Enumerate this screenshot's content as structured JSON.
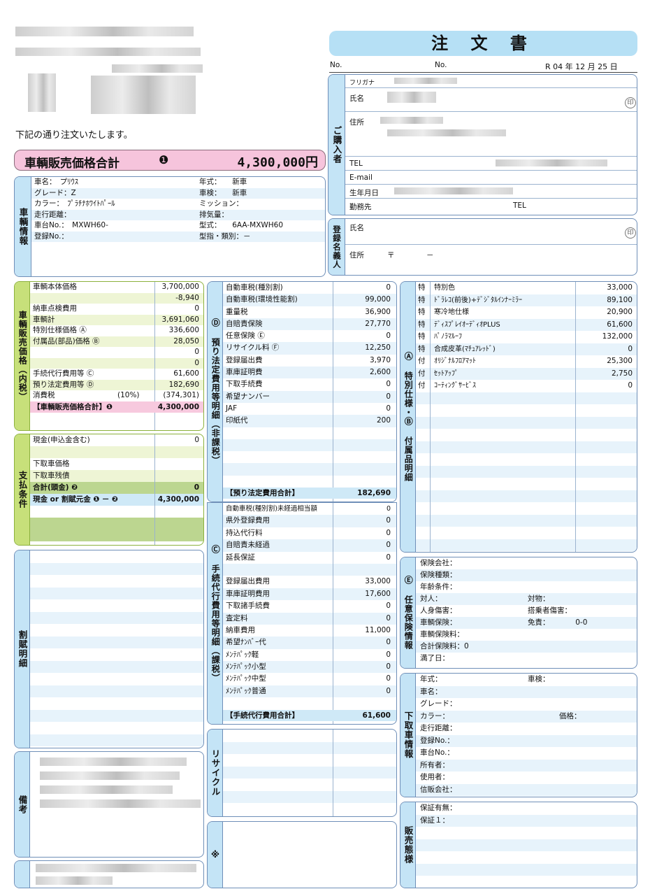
{
  "header": {
    "title": "注 文 書",
    "no_label1": "No.",
    "no_label2": "No.",
    "date": "R 04 年 12 月 25 日",
    "intro": "下記の通り注文いたします。"
  },
  "total": {
    "label": "車輌販売価格合計",
    "badge": "❶",
    "value": "4,300,000円"
  },
  "buyer": {
    "section": "ご購入者",
    "furigana": "フリガナ",
    "name": "氏名",
    "address": "住所",
    "tel": "TEL",
    "email": "E-mail",
    "birthday": "生年月日",
    "workplace": "勤務先",
    "work_tel": "TEL",
    "seal": "印"
  },
  "registrant": {
    "section": "登録名義人",
    "name": "氏名",
    "address": "住所",
    "postal": "〒",
    "dash": "－",
    "seal": "印"
  },
  "vehicle": {
    "section": "車輌情報",
    "rows": [
      [
        "車名：　プﾘｳｽ",
        "年式：　　新車"
      ],
      [
        "グレード：Z",
        "車検：　　新車"
      ],
      [
        "カラー：　ﾌﾟﾗﾁﾅﾎﾜｲﾄﾊﾟｰﾙ",
        "ミッション："
      ],
      [
        "走行距離：",
        "排気量："
      ],
      [
        "車台No.：　MXWH60-",
        "型式：　　6AA-MXWH60"
      ],
      [
        "登録No.：",
        "型指・類別：－"
      ]
    ]
  },
  "price": {
    "section": "車輌販売価格（内税）",
    "rows": [
      [
        "車輌本体価格",
        "3,700,000"
      ],
      [
        "",
        "-8,940"
      ],
      [
        "納車点検費用",
        "0"
      ],
      [
        "車輌計",
        "3,691,060"
      ],
      [
        "特別仕様価格 Ⓐ",
        "336,600"
      ],
      [
        "付属品(部品)価格 Ⓑ",
        "28,050"
      ],
      [
        "",
        "0"
      ],
      [
        "",
        "0"
      ],
      [
        "手続代行費用等 Ⓒ",
        "61,600"
      ],
      [
        "預り法定費用等 Ⓓ",
        "182,690"
      ],
      [
        "消費税",
        "(374,301)"
      ]
    ],
    "tax_rate": "(10%)",
    "total_label": "【車輌販売価格合計】❶",
    "total_value": "4,300,000"
  },
  "payment": {
    "section": "支払条件",
    "rows": [
      [
        "現金(申込金含む)",
        "0"
      ],
      [
        "",
        ""
      ],
      [
        "下取車価格",
        ""
      ],
      [
        "下取車残債",
        ""
      ],
      [
        "合計(頭金) ❷",
        "0"
      ],
      [
        "現金 or 割賦元金 ❶ － ❷",
        "4,300,000"
      ],
      [
        "",
        ""
      ],
      [
        "",
        ""
      ],
      [
        "",
        ""
      ]
    ]
  },
  "installment": {
    "section": "割賦明細"
  },
  "remarks": {
    "section": "備考"
  },
  "legal": {
    "section": "Ⓓ 預り法定費用等明細（非課税）",
    "rows": [
      [
        "自動車税(種別割)",
        "0"
      ],
      [
        "自動車税(環境性能割)",
        "99,000"
      ],
      [
        "重量税",
        "36,900"
      ],
      [
        "自賠責保険",
        "27,770"
      ],
      [
        "任意保険 Ⓔ",
        "0"
      ],
      [
        "リサイクル料 Ⓕ",
        "12,250"
      ],
      [
        "登録届出費",
        "3,970"
      ],
      [
        "車庫証明費",
        "2,600"
      ],
      [
        "下取手続費",
        "0"
      ],
      [
        "希望ナンバー",
        "0"
      ],
      [
        "JAF",
        "0"
      ],
      [
        "印紙代",
        "200"
      ],
      [
        "",
        ""
      ],
      [
        "",
        ""
      ],
      [
        "",
        ""
      ],
      [
        "",
        ""
      ],
      [
        "",
        ""
      ]
    ],
    "total_label": "【預り法定費用合計】",
    "total_value": "182,690"
  },
  "procedure": {
    "section": "Ⓒ 手続代行費用等明細（課税）",
    "rows": [
      [
        "自動車税(種別割)未経過相当額",
        "0"
      ],
      [
        "県外登録費用",
        "0"
      ],
      [
        "持込代行料",
        "0"
      ],
      [
        "自賠責未経過",
        "0"
      ],
      [
        "延長保証",
        "0"
      ],
      [
        "",
        ""
      ],
      [
        "登録届出費用",
        "33,000"
      ],
      [
        "車庫証明費用",
        "17,600"
      ],
      [
        "下取諸手続費",
        "0"
      ],
      [
        "査定料",
        "0"
      ],
      [
        "納車費用",
        "11,000"
      ],
      [
        "希望ﾅﾝﾊﾞｰ代",
        "0"
      ],
      [
        "ﾒﾝﾃﾊﾟｯｸ軽",
        "0"
      ],
      [
        "ﾒﾝﾃﾊﾟｯｸ小型",
        "0"
      ],
      [
        "ﾒﾝﾃﾊﾟｯｸ中型",
        "0"
      ],
      [
        "ﾒﾝﾃﾊﾟｯｸ普通",
        "0"
      ],
      [
        "",
        ""
      ]
    ],
    "total_label": "【手続代行費用合計】",
    "total_value": "61,600"
  },
  "recycle": {
    "section": "リサイクル"
  },
  "note": {
    "section": "※"
  },
  "options": {
    "section": "Ⓐ 特別仕様・Ⓑ 付属品明細",
    "rows": [
      [
        "特",
        "特別色",
        "33,000"
      ],
      [
        "特",
        "ﾄﾞﾗﾚｺ(前後)+ﾃﾞｼﾞﾀﾙｲﾝﾅｰﾐﾗｰ",
        "89,100"
      ],
      [
        "特",
        "寒冷地仕様",
        "20,900"
      ],
      [
        "特",
        "ﾃﾞｨｽﾌﾟﾚｲｵｰﾃﾞｨｵPLUS",
        "61,600"
      ],
      [
        "特",
        "ﾊﾟﾉﾗﾏﾙｰﾌ",
        "132,000"
      ],
      [
        "特",
        "合成皮革(ﾏﾁｭｱﾚｯﾄﾞ)",
        "0"
      ],
      [
        "付",
        "ｵﾘｼﾞﾅﾙﾌﾛｱﾏｯﾄ",
        "25,300"
      ],
      [
        "付",
        "ｾｯﾄｱｯﾌﾟ",
        "2,750"
      ],
      [
        "付",
        "ｺｰﾃｨﾝｸﾞｻｰﾋﾞｽ",
        "0"
      ]
    ]
  },
  "insurance": {
    "section": "Ⓔ 任意保険情報",
    "rows": [
      [
        "保険会社：",
        ""
      ],
      [
        "保険種類：",
        ""
      ],
      [
        "年齢条件：",
        ""
      ],
      [
        "対人：",
        "対物："
      ],
      [
        "人身傷害：",
        "搭乗者傷害："
      ],
      [
        "車輌保険：",
        "免責：　　　　0-0"
      ],
      [
        "車輌保険料：",
        ""
      ],
      [
        "合計保険料：0",
        ""
      ],
      [
        "満了日：",
        ""
      ]
    ]
  },
  "tradein": {
    "section": "下取車情報",
    "rows": [
      [
        "年式：",
        "車検："
      ],
      [
        "車名：",
        ""
      ],
      [
        "グレード：",
        ""
      ],
      [
        "カラー：",
        "価格："
      ],
      [
        "走行距離：",
        ""
      ],
      [
        "登録No.：",
        ""
      ],
      [
        "車台No.：",
        ""
      ],
      [
        "所有者：",
        ""
      ],
      [
        "使用者：",
        ""
      ],
      [
        "信販会社：",
        ""
      ]
    ]
  },
  "sales": {
    "section": "販売態様",
    "rows": [
      [
        "保証有無："
      ],
      [
        "保証１："
      ]
    ]
  }
}
